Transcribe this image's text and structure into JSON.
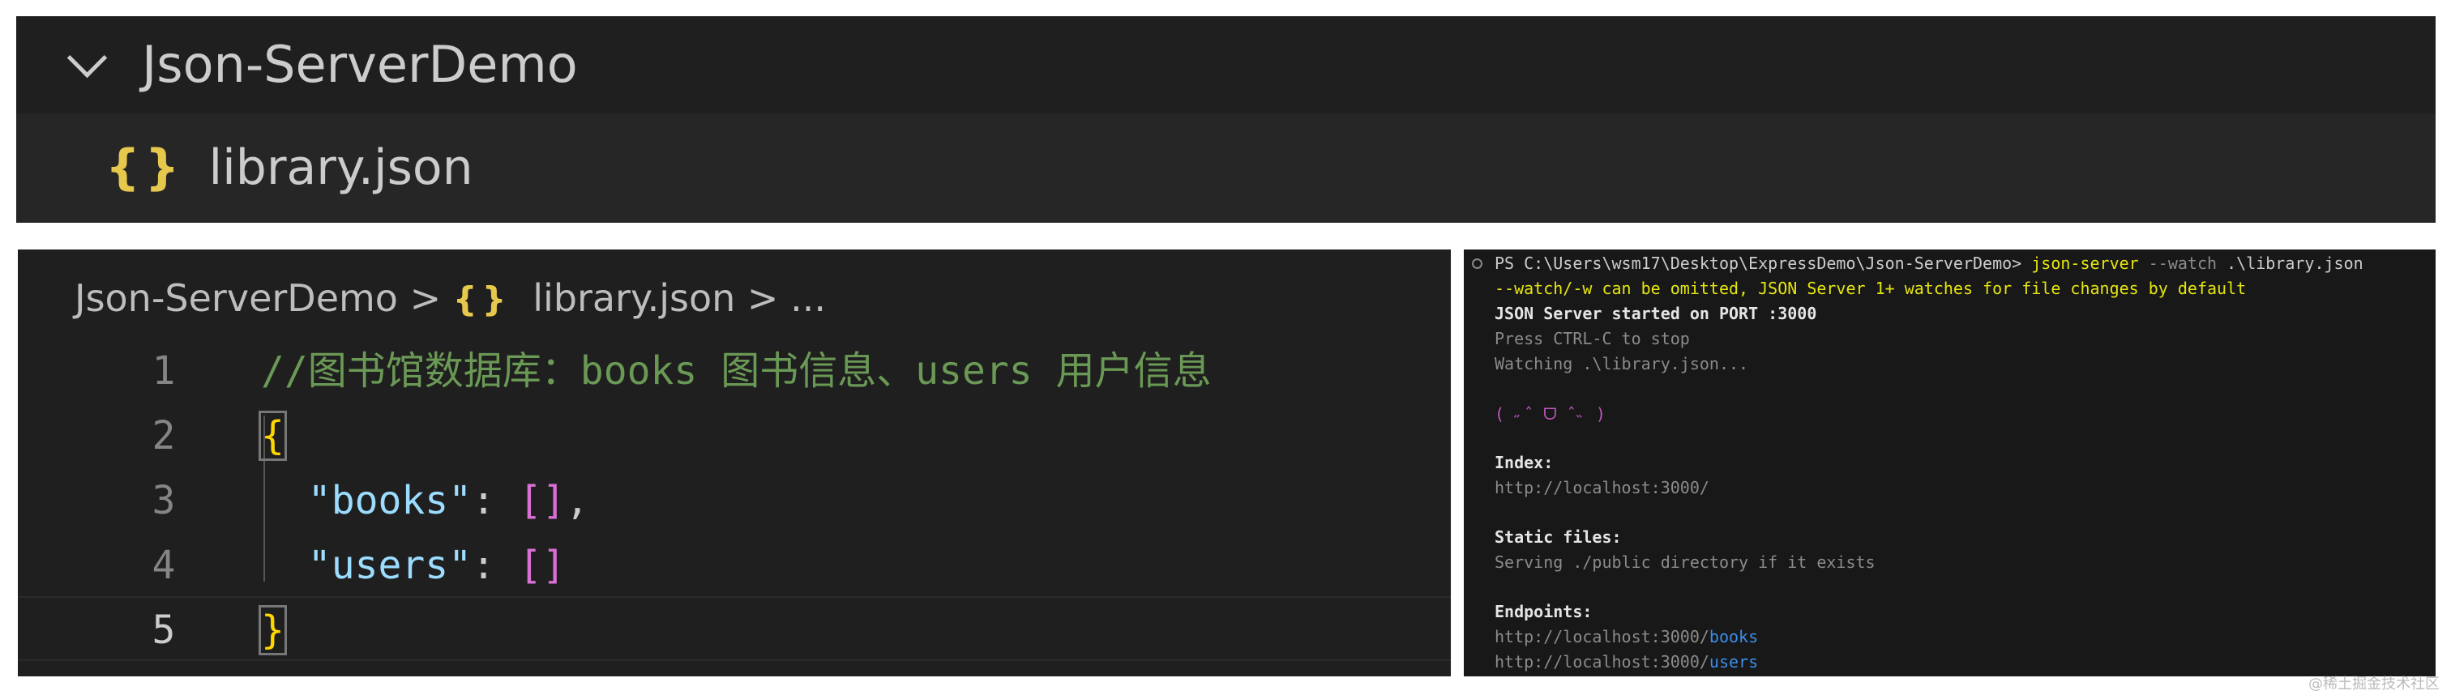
{
  "explorer": {
    "folder": "Json-ServerDemo",
    "file": "library.json",
    "file_icon": "{}"
  },
  "editor": {
    "breadcrumb": {
      "folder": "Json-ServerDemo",
      "sep": ">",
      "icon": "{}",
      "file": "library.json",
      "more": "..."
    },
    "lines": [
      {
        "n": "1",
        "text": "//图书馆数据库：books 图书信息、users 用户信息"
      },
      {
        "n": "2",
        "text": "{"
      },
      {
        "n": "3",
        "key": "\"books\"",
        "colon": ": ",
        "value": "[]",
        "tail": ","
      },
      {
        "n": "4",
        "key": "\"users\"",
        "colon": ": ",
        "value": "[]"
      },
      {
        "n": "5",
        "text": "}"
      }
    ]
  },
  "terminal": {
    "prompt": "PS C:\\Users\\wsm17\\Desktop\\ExpressDemo\\Json-ServerDemo> ",
    "cmd": "json-server",
    "flag": " --watch",
    "arg": " .\\library.json",
    "warn": "--watch/-w can be omitted, JSON Server 1+ watches for file changes by default",
    "started": "JSON Server started on PORT :3000",
    "stop": "Press CTRL-C to stop",
    "watching": "Watching .\\library.json...",
    "face": "( ˶ˆ ᗜ ˆ˵ )",
    "index_label": "Index:",
    "index_url": "http://localhost:3000/",
    "static_label": "Static files:",
    "static_text": "Serving ./public directory if it exists",
    "endpoints_label": "Endpoints:",
    "endpoint_base": "http://localhost:3000/",
    "endpoints": [
      "books",
      "users"
    ]
  },
  "watermark": "@稀土掘金技术社区"
}
